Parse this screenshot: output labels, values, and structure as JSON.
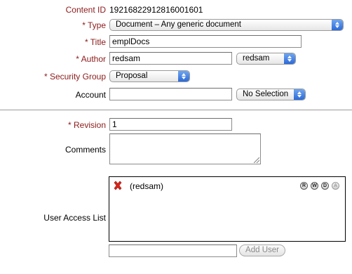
{
  "content_id": {
    "label": "Content ID",
    "value": "192168229128160016​01"
  },
  "type": {
    "label": "* Type",
    "selected": "Document – Any generic document"
  },
  "title": {
    "label": "* Title",
    "value": "emplDocs"
  },
  "author": {
    "label": "* Author",
    "value": "redsam",
    "selected": "redsam"
  },
  "security_group": {
    "label": "* Security Group",
    "selected": "Proposal"
  },
  "account": {
    "label": "Account",
    "value": "",
    "selected": "No Selection"
  },
  "revision": {
    "label": "* Revision",
    "value": "1"
  },
  "comments": {
    "label": "Comments",
    "value": ""
  },
  "user_access_list": {
    "label": "User Access List",
    "entries": [
      {
        "user": "(redsam)",
        "permissions": [
          "R",
          "W",
          "D",
          "A"
        ]
      }
    ],
    "add_input_value": "",
    "add_button_label": "Add User"
  },
  "colors": {
    "required_label": "#8b1a1a",
    "select_arrow": "#2c6ad8",
    "remove_icon": "#d9261c"
  }
}
